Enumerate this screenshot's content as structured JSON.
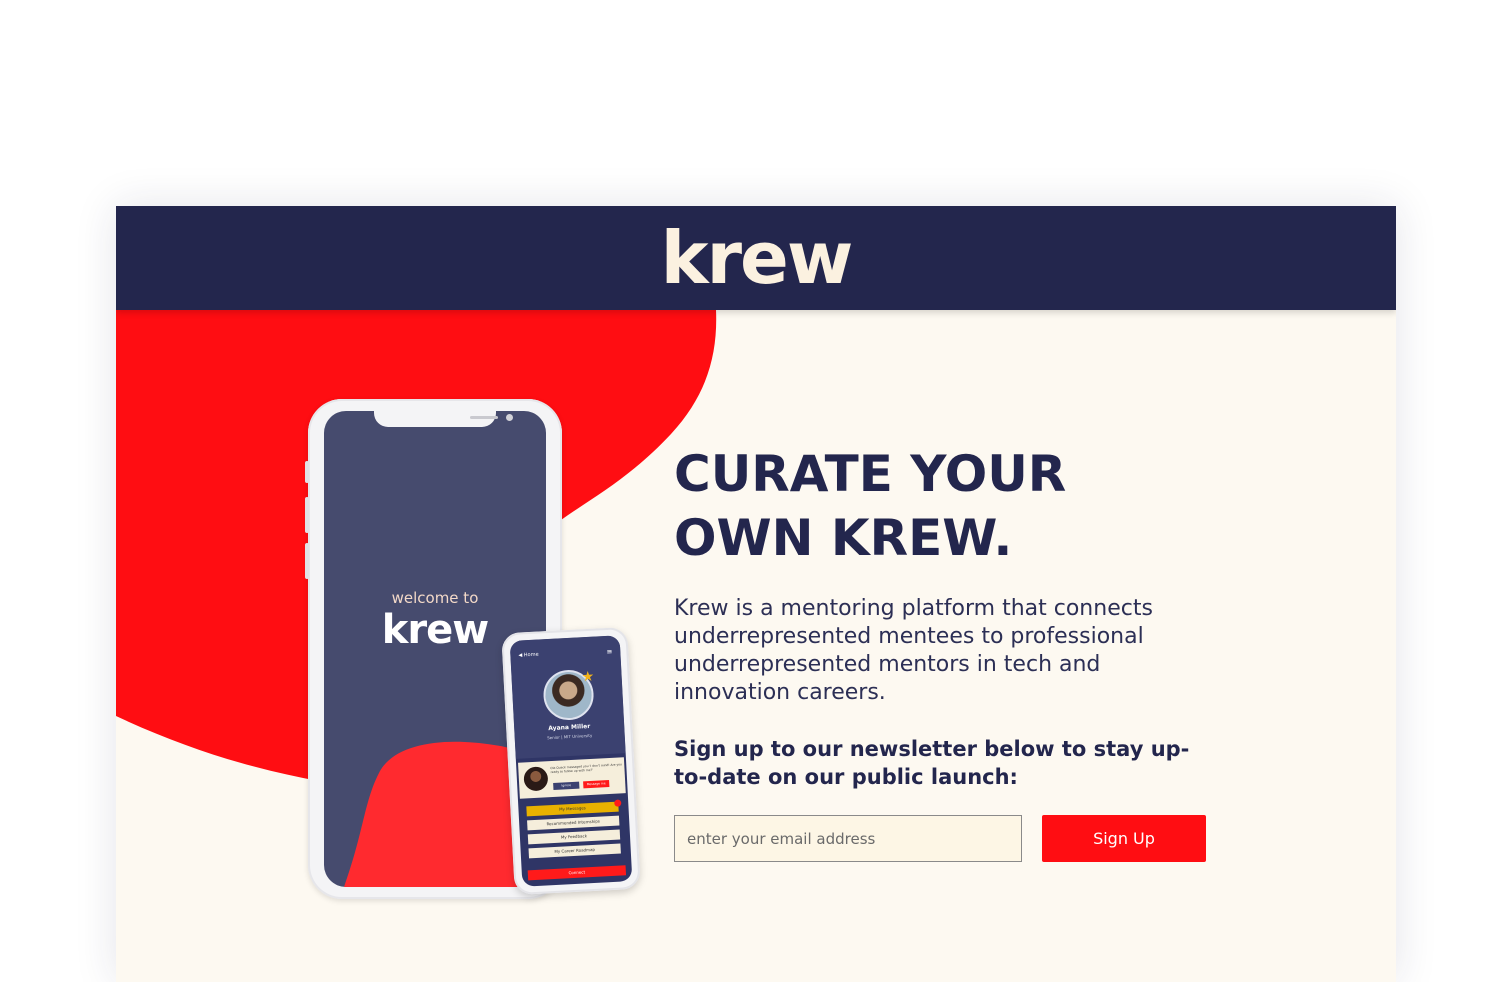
{
  "header": {
    "logo_text": "krew"
  },
  "hero": {
    "headline_line1": "CURATE YOUR",
    "headline_line2": "OWN KREW.",
    "description": "Krew is a mentoring platform that connects underrepresented mentees to professional underrepresented mentors in tech and innovation careers.",
    "newsletter_text": "Sign up to our newsletter below to stay up-to-date on our public launch:"
  },
  "signup_form": {
    "email_placeholder": "enter your email address",
    "email_value": "",
    "submit_label": "Sign Up"
  },
  "phone_large": {
    "welcome_text": "welcome to",
    "logo_text": "krew"
  },
  "phone_small": {
    "back_label": "◀ Home",
    "menu_glyph": "≡",
    "profile_name": "Ayana Miller",
    "profile_subtitle": "Senior | MIT University",
    "card_text": "Ola Quack messaged you 'I don't mind! Are you ready to follow up with me?'",
    "card_button_1": "Ignore",
    "card_button_2": "Message me",
    "menu_items": [
      "My Messages",
      "Recommended Internships",
      "My Feedback",
      "My Career Roadmap"
    ],
    "connect_label": "Connect"
  },
  "colors": {
    "navy": "#23264d",
    "red": "#ff0d12",
    "cream": "#fdf9f1",
    "logo_cream": "#fbf1e0",
    "phone_screen": "#464b6e"
  }
}
